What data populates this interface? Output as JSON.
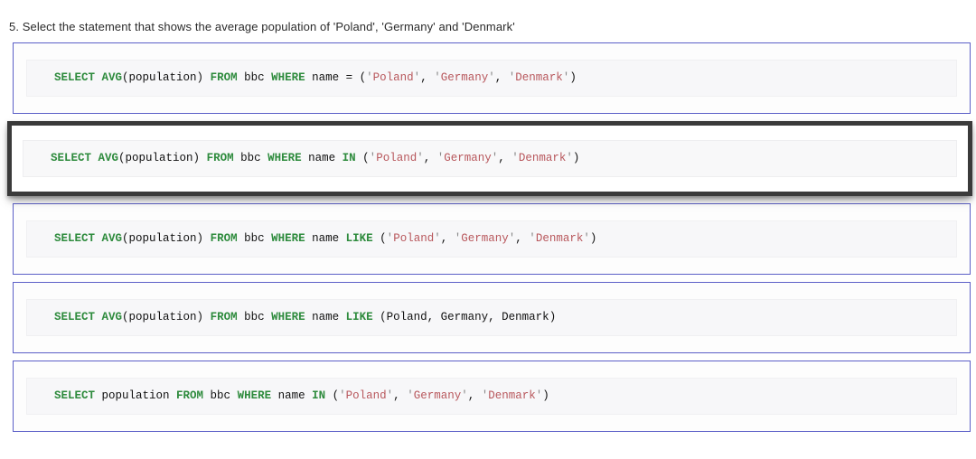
{
  "question": {
    "number": "5.",
    "text": "5. Select the statement that shows the average population of 'Poland', 'Germany' and 'Denmark'"
  },
  "theme": {
    "keyword_color": "#2e8b3d",
    "string_color": "#b8575c",
    "quote_color": "#8a8a8a",
    "plain_color": "#111111",
    "option_border_color": "#5b5fc7",
    "selected_border_color": "#3a3a3a",
    "code_background": "#f7f7f9",
    "card_background": "#fdfdfd"
  },
  "options": [
    {
      "id": "option-1",
      "selected": false,
      "sql": "SELECT AVG(population) FROM bbc WHERE name = ('Poland', 'Germany', 'Denmark')",
      "tokens": [
        {
          "t": "kw",
          "v": "SELECT"
        },
        {
          "t": "plain",
          "v": " "
        },
        {
          "t": "kw",
          "v": "AVG"
        },
        {
          "t": "plain",
          "v": "(population) "
        },
        {
          "t": "kw",
          "v": "FROM"
        },
        {
          "t": "plain",
          "v": " bbc "
        },
        {
          "t": "kw",
          "v": "WHERE"
        },
        {
          "t": "plain",
          "v": " name = ("
        },
        {
          "t": "quote",
          "v": "'"
        },
        {
          "t": "str",
          "v": "Poland"
        },
        {
          "t": "quote",
          "v": "'"
        },
        {
          "t": "plain",
          "v": ", "
        },
        {
          "t": "quote",
          "v": "'"
        },
        {
          "t": "str",
          "v": "Germany"
        },
        {
          "t": "quote",
          "v": "'"
        },
        {
          "t": "plain",
          "v": ", "
        },
        {
          "t": "quote",
          "v": "'"
        },
        {
          "t": "str",
          "v": "Denmark"
        },
        {
          "t": "quote",
          "v": "'"
        },
        {
          "t": "plain",
          "v": ")"
        }
      ]
    },
    {
      "id": "option-2",
      "selected": true,
      "sql": "SELECT AVG(population) FROM bbc WHERE name IN ('Poland', 'Germany', 'Denmark')",
      "tokens": [
        {
          "t": "kw",
          "v": "SELECT"
        },
        {
          "t": "plain",
          "v": " "
        },
        {
          "t": "kw",
          "v": "AVG"
        },
        {
          "t": "plain",
          "v": "(population) "
        },
        {
          "t": "kw",
          "v": "FROM"
        },
        {
          "t": "plain",
          "v": " bbc "
        },
        {
          "t": "kw",
          "v": "WHERE"
        },
        {
          "t": "plain",
          "v": " name "
        },
        {
          "t": "kw",
          "v": "IN"
        },
        {
          "t": "plain",
          "v": " ("
        },
        {
          "t": "quote",
          "v": "'"
        },
        {
          "t": "str",
          "v": "Poland"
        },
        {
          "t": "quote",
          "v": "'"
        },
        {
          "t": "plain",
          "v": ", "
        },
        {
          "t": "quote",
          "v": "'"
        },
        {
          "t": "str",
          "v": "Germany"
        },
        {
          "t": "quote",
          "v": "'"
        },
        {
          "t": "plain",
          "v": ", "
        },
        {
          "t": "quote",
          "v": "'"
        },
        {
          "t": "str",
          "v": "Denmark"
        },
        {
          "t": "quote",
          "v": "'"
        },
        {
          "t": "plain",
          "v": ")"
        }
      ]
    },
    {
      "id": "option-3",
      "selected": false,
      "sql": "SELECT AVG(population) FROM bbc WHERE name LIKE ('Poland', 'Germany', 'Denmark')",
      "tokens": [
        {
          "t": "kw",
          "v": "SELECT"
        },
        {
          "t": "plain",
          "v": " "
        },
        {
          "t": "kw",
          "v": "AVG"
        },
        {
          "t": "plain",
          "v": "(population) "
        },
        {
          "t": "kw",
          "v": "FROM"
        },
        {
          "t": "plain",
          "v": " bbc "
        },
        {
          "t": "kw",
          "v": "WHERE"
        },
        {
          "t": "plain",
          "v": " name "
        },
        {
          "t": "kw",
          "v": "LIKE"
        },
        {
          "t": "plain",
          "v": " ("
        },
        {
          "t": "quote",
          "v": "'"
        },
        {
          "t": "str",
          "v": "Poland"
        },
        {
          "t": "quote",
          "v": "'"
        },
        {
          "t": "plain",
          "v": ", "
        },
        {
          "t": "quote",
          "v": "'"
        },
        {
          "t": "str",
          "v": "Germany"
        },
        {
          "t": "quote",
          "v": "'"
        },
        {
          "t": "plain",
          "v": ", "
        },
        {
          "t": "quote",
          "v": "'"
        },
        {
          "t": "str",
          "v": "Denmark"
        },
        {
          "t": "quote",
          "v": "'"
        },
        {
          "t": "plain",
          "v": ")"
        }
      ]
    },
    {
      "id": "option-4",
      "selected": false,
      "sql": "SELECT AVG(population) FROM bbc WHERE name LIKE (Poland, Germany, Denmark)",
      "tokens": [
        {
          "t": "kw",
          "v": "SELECT"
        },
        {
          "t": "plain",
          "v": " "
        },
        {
          "t": "kw",
          "v": "AVG"
        },
        {
          "t": "plain",
          "v": "(population) "
        },
        {
          "t": "kw",
          "v": "FROM"
        },
        {
          "t": "plain",
          "v": " bbc "
        },
        {
          "t": "kw",
          "v": "WHERE"
        },
        {
          "t": "plain",
          "v": " name "
        },
        {
          "t": "kw",
          "v": "LIKE"
        },
        {
          "t": "plain",
          "v": " (Poland, Germany, Denmark)"
        }
      ]
    },
    {
      "id": "option-5",
      "selected": false,
      "sql": "SELECT population FROM bbc WHERE name IN ('Poland', 'Germany', 'Denmark')",
      "tokens": [
        {
          "t": "kw",
          "v": "SELECT"
        },
        {
          "t": "plain",
          "v": " population "
        },
        {
          "t": "kw",
          "v": "FROM"
        },
        {
          "t": "plain",
          "v": " bbc "
        },
        {
          "t": "kw",
          "v": "WHERE"
        },
        {
          "t": "plain",
          "v": " name "
        },
        {
          "t": "kw",
          "v": "IN"
        },
        {
          "t": "plain",
          "v": " ("
        },
        {
          "t": "quote",
          "v": "'"
        },
        {
          "t": "str",
          "v": "Poland"
        },
        {
          "t": "quote",
          "v": "'"
        },
        {
          "t": "plain",
          "v": ", "
        },
        {
          "t": "quote",
          "v": "'"
        },
        {
          "t": "str",
          "v": "Germany"
        },
        {
          "t": "quote",
          "v": "'"
        },
        {
          "t": "plain",
          "v": ", "
        },
        {
          "t": "quote",
          "v": "'"
        },
        {
          "t": "str",
          "v": "Denmark"
        },
        {
          "t": "quote",
          "v": "'"
        },
        {
          "t": "plain",
          "v": ")"
        }
      ]
    }
  ]
}
